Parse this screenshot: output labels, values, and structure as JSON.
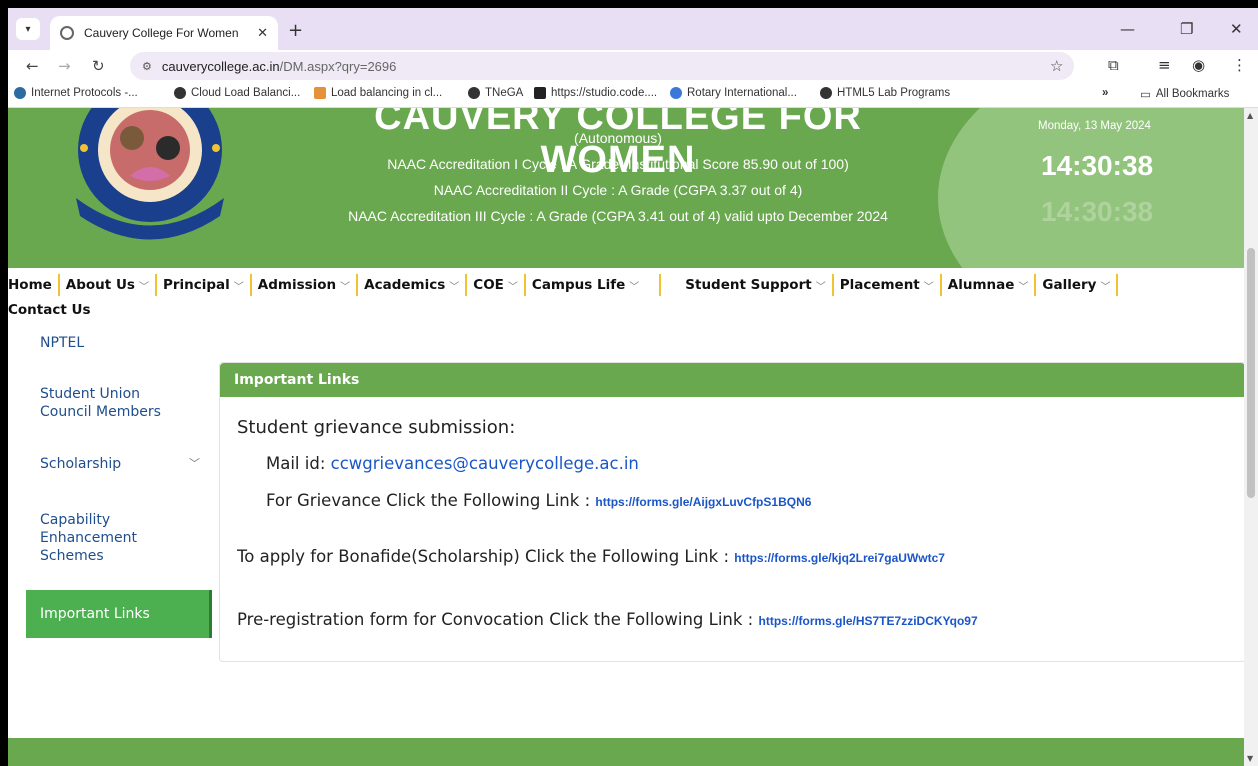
{
  "browser": {
    "tab_title": "Cauvery College For Women",
    "url_host": "cauverycollege.ac.in",
    "url_path": "/DM.aspx?qry=2696",
    "bookmarks": [
      "Internet Protocols -...",
      "Cloud Load Balanci...",
      "Load balancing in cl...",
      "TNeGA",
      "https://studio.code....",
      "Rotary International...",
      "HTML5 Lab Programs"
    ],
    "bookmarks_more": "»",
    "all_bookmarks": "All Bookmarks"
  },
  "header": {
    "college_name": "CAUVERY COLLEGE FOR WOMEN",
    "autonomous": "(Autonomous)",
    "naac_1": "NAAC Accreditation I Cycle : A Grade (Institutional Score 85.90 out of 100)",
    "naac_2": "NAAC Accreditation II Cycle : A Grade (CGPA 3.37 out of 4)",
    "naac_3": "NAAC Accreditation III Cycle : A Grade (CGPA 3.41 out of 4) valid upto December 2024",
    "date": "Monday, 13 May 2024",
    "time": "14:30:38"
  },
  "menu": {
    "items": [
      {
        "label": "Home",
        "dropdown": false
      },
      {
        "label": "About Us",
        "dropdown": true
      },
      {
        "label": "Principal",
        "dropdown": true
      },
      {
        "label": "Admission",
        "dropdown": true
      },
      {
        "label": "Academics",
        "dropdown": true
      },
      {
        "label": "COE",
        "dropdown": true
      },
      {
        "label": "Campus Life",
        "dropdown": true
      },
      {
        "label": "Student Support",
        "dropdown": true
      },
      {
        "label": "Placement",
        "dropdown": true
      },
      {
        "label": "Alumnae",
        "dropdown": true
      },
      {
        "label": "Gallery",
        "dropdown": true
      }
    ],
    "contact": "Contact Us"
  },
  "sidebar": {
    "items": [
      {
        "label": "NPTEL"
      },
      {
        "label": "Student Union Council Members"
      },
      {
        "label": "Scholarship"
      },
      {
        "label": "Capability Enhancement Schemes"
      },
      {
        "label": "Important Links"
      }
    ]
  },
  "content": {
    "title": "Important Links",
    "grievance_heading": "Student grievance submission:",
    "mail_label": "Mail id:",
    "mail_value": "ccwgrievances@cauverycollege.ac.in",
    "grievance_text": "For Grievance Click the Following Link :",
    "grievance_link": "https://forms.gle/AijgxLuvCfpS1BQN6",
    "bonafide_text": "To apply for Bonafide(Scholarship) Click the Following Link :",
    "bonafide_link": "https://forms.gle/kjq2Lrei7gaUWwtc7",
    "convocation_text": "Pre-registration form for Convocation Click the Following Link :",
    "convocation_link": "https://forms.gle/HS7TE7zziDCKYqo97"
  },
  "colors": {
    "header_green": "#6aa84f",
    "clock_green": "#93c47d",
    "active_green": "#4caf50",
    "menu_divider": "#f1c232",
    "link_blue": "#1a56c8"
  }
}
